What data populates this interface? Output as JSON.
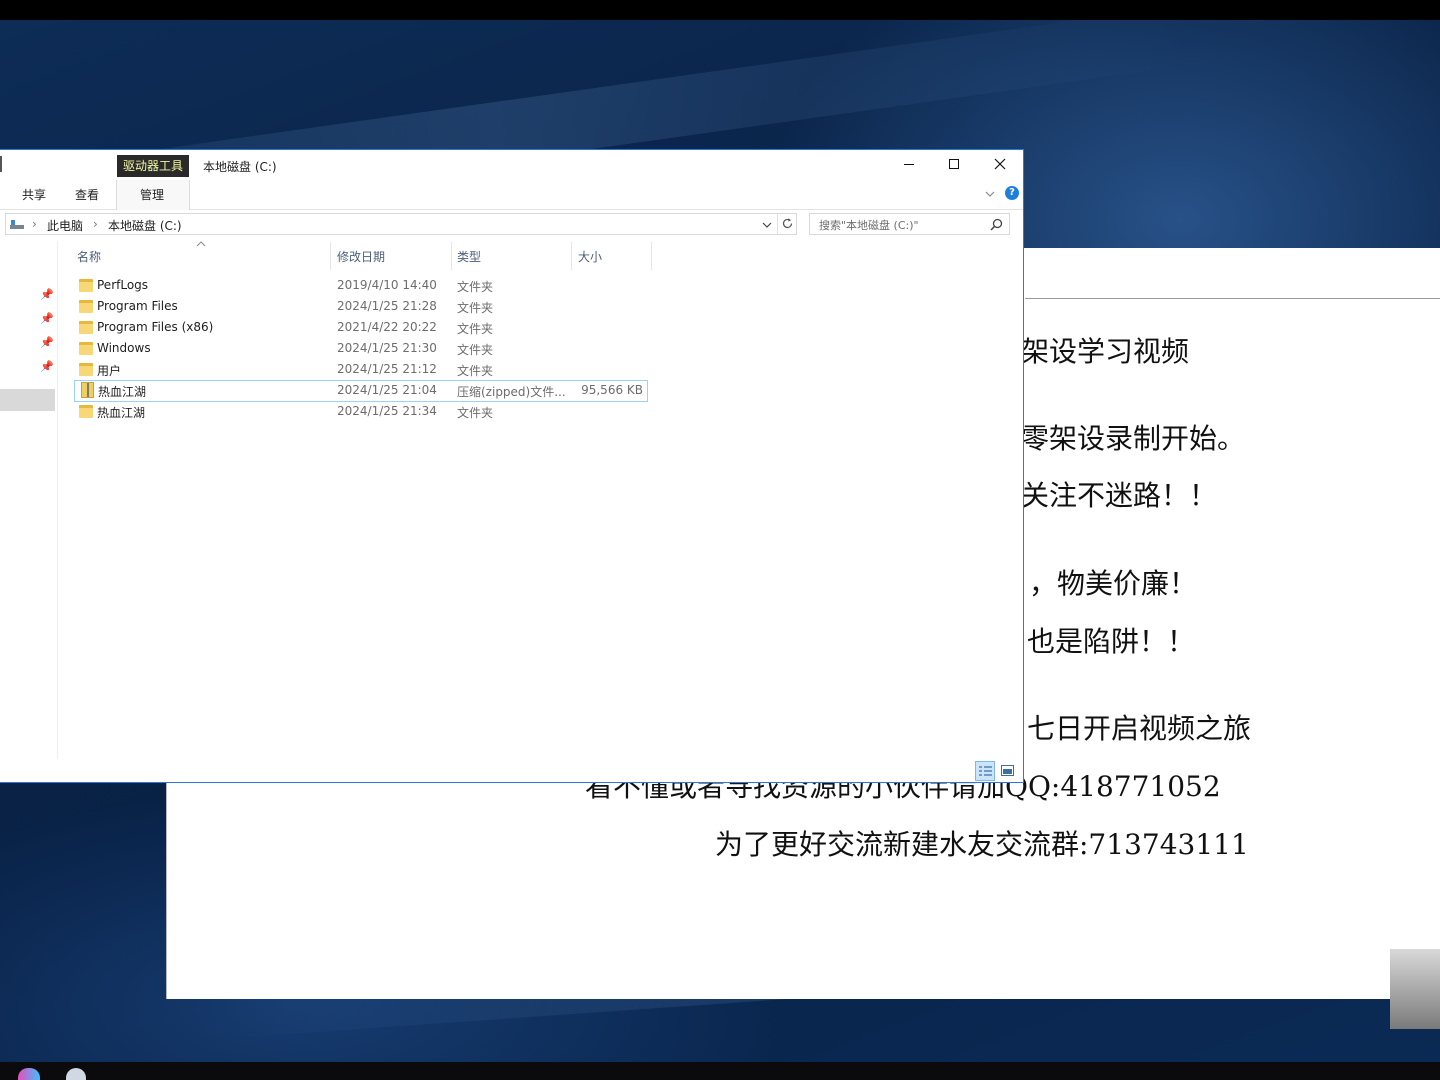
{
  "explorer": {
    "context_tab": "驱动器工具",
    "title": "本地磁盘 (C:)",
    "ribbon_tabs": [
      "共享",
      "查看",
      "管理"
    ],
    "breadcrumb": [
      "此电脑",
      "本地磁盘 (C:)"
    ],
    "search_placeholder": "搜索\"本地磁盘 (C:)\"",
    "columns": {
      "name": "名称",
      "date": "修改日期",
      "type": "类型",
      "size": "大小"
    },
    "rows": [
      {
        "name": "PerfLogs",
        "date": "2019/4/10 14:40",
        "type": "文件夹",
        "size": "",
        "icon": "folder-icon"
      },
      {
        "name": "Program Files",
        "date": "2024/1/25 21:28",
        "type": "文件夹",
        "size": "",
        "icon": "folder-icon"
      },
      {
        "name": "Program Files (x86)",
        "date": "2021/4/22 20:22",
        "type": "文件夹",
        "size": "",
        "icon": "folder-icon"
      },
      {
        "name": "Windows",
        "date": "2024/1/25 21:30",
        "type": "文件夹",
        "size": "",
        "icon": "folder-icon"
      },
      {
        "name": "用户",
        "date": "2024/1/25 21:12",
        "type": "文件夹",
        "size": "",
        "icon": "folder-icon"
      },
      {
        "name": "热血江湖",
        "date": "2024/1/25 21:04",
        "type": "压缩(zipped)文件...",
        "size": "95,566 KB",
        "icon": "zip-icon",
        "selected": true
      },
      {
        "name": "热血江湖",
        "date": "2024/1/25 21:34",
        "type": "文件夹",
        "size": "",
        "icon": "folder-icon"
      }
    ],
    "colors": {
      "accent": "#2b79d0",
      "selection_border": "#99d1ff",
      "help": "#1e7fd8"
    }
  },
  "document": {
    "lines": [
      "架设学习视频",
      "零架设录制开始。",
      "关注不迷路！！",
      "，物美价廉！",
      "也是陷阱！！",
      "七日开启视频之旅",
      "看不懂或者寻找资源的小伙伴请加QQ:418771052",
      "为了更好交流新建水友交流群:713743111"
    ]
  }
}
